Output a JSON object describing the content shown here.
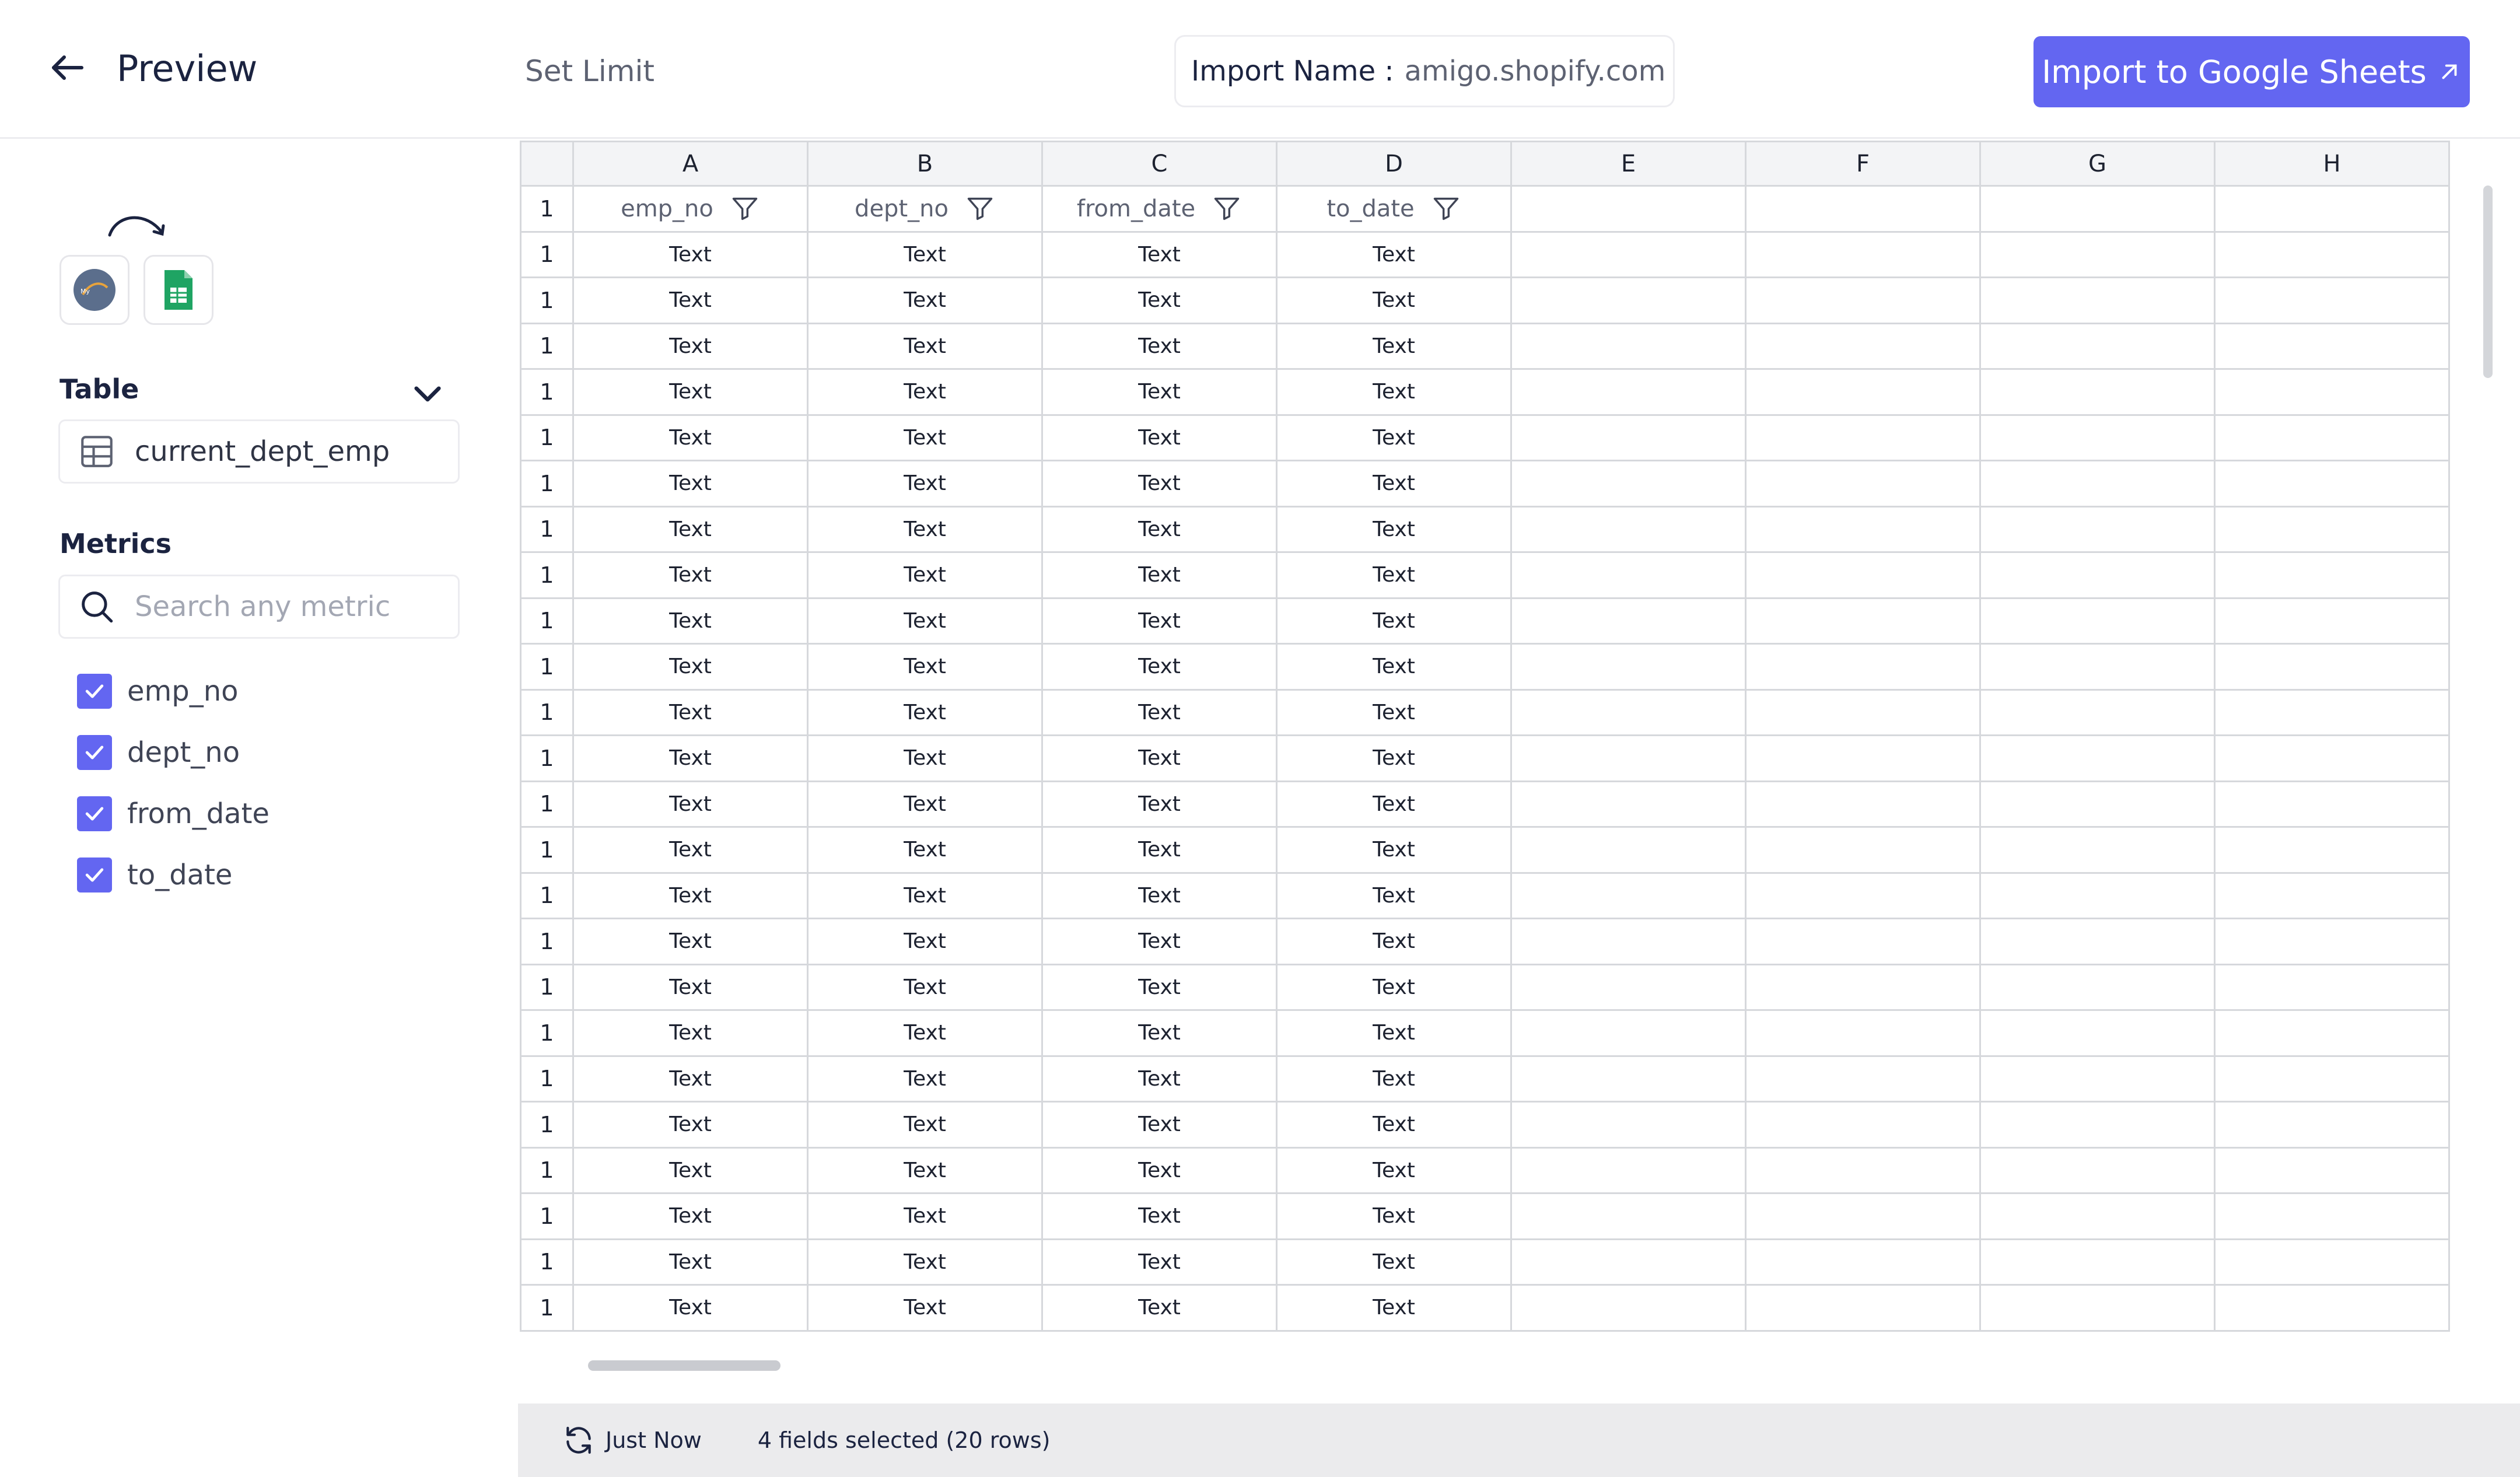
{
  "header": {
    "title": "Preview",
    "set_limit": "Set Limit",
    "import_name_label": "Import Name :",
    "import_name_value": "amigo.shopify.com",
    "import_button": "Import to Google Sheets"
  },
  "sidebar": {
    "sources": [
      {
        "name": "mysql-logo-icon"
      },
      {
        "name": "google-sheets-icon"
      }
    ],
    "table_title": "Table",
    "table_value": "current_dept_emp",
    "metrics_title": "Metrics",
    "search_placeholder": "Search any metric",
    "metrics": [
      {
        "label": "emp_no",
        "checked": true
      },
      {
        "label": "dept_no",
        "checked": true
      },
      {
        "label": "from_date",
        "checked": true
      },
      {
        "label": "to_date",
        "checked": true
      }
    ]
  },
  "grid": {
    "columns": [
      "A",
      "B",
      "C",
      "D",
      "E",
      "F",
      "G",
      "H"
    ],
    "fields": [
      "emp_no",
      "dept_no",
      "from_date",
      "to_date"
    ],
    "header_row_number": "1",
    "row_number": "1",
    "cell_text": "Text",
    "row_count": 24
  },
  "footer": {
    "refresh_label": "Just Now",
    "selection_summary": "4 fields selected (20 rows)"
  },
  "colors": {
    "accent": "#6366f1",
    "grid_border": "#d6d8dc",
    "footer_bg": "#ebebed"
  }
}
